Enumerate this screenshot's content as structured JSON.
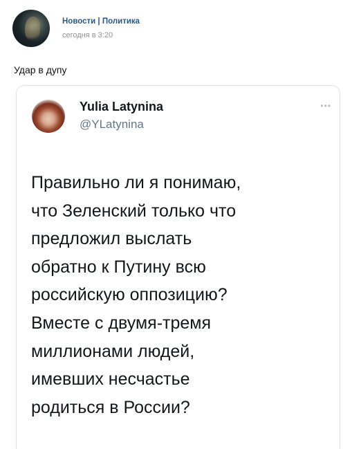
{
  "post": {
    "group_name": "Новости | Политика",
    "time": "сегодня в 3:20",
    "text": "Удар в дупу"
  },
  "tweet": {
    "author_name": "Yulia Latynina",
    "author_handle": "@YLatynina",
    "more_icon": "more-horizontal-icon",
    "lines": [
      "Правильно ли я понимаю,",
      "что Зеленский только что",
      "предложил выслать",
      "обратно к Путину всю",
      "российскую оппозицию?",
      "Вместе с двумя-тремя",
      "миллионами людей,",
      "имевших несчастье",
      "родиться в России?"
    ]
  },
  "colors": {
    "group_link": "#2a5885",
    "muted": "#939393",
    "handle": "#657786",
    "card_border": "#dfe3e8"
  }
}
